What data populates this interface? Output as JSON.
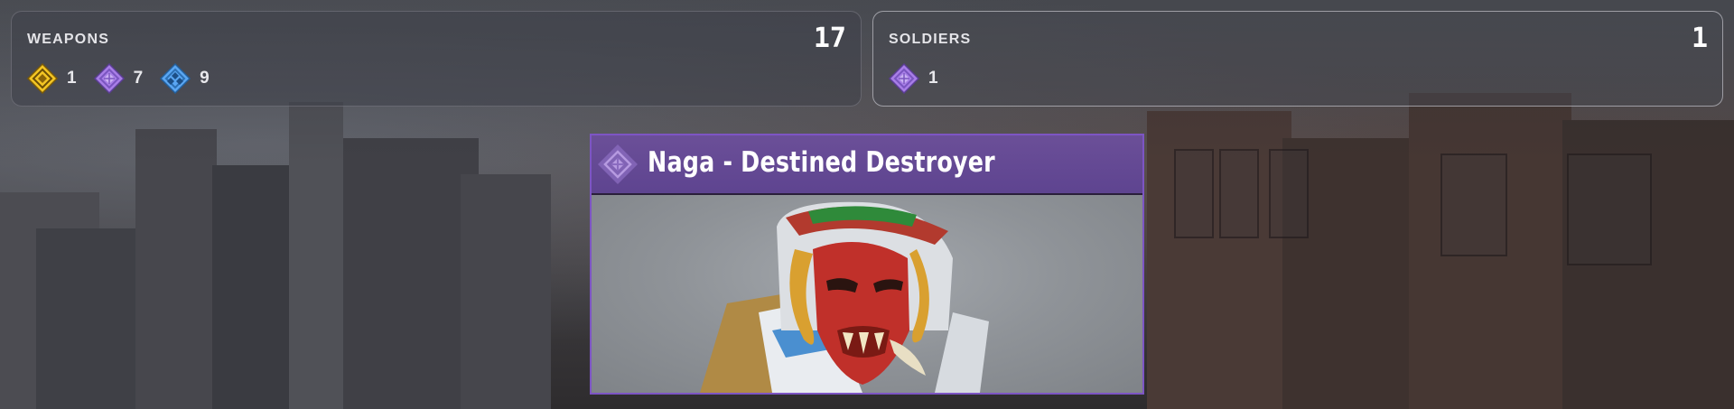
{
  "weapons": {
    "label": "WEAPONS",
    "total": "17",
    "rarities": [
      {
        "icon": "rare-diamond-icon",
        "color": "#f3c524",
        "count": "1"
      },
      {
        "icon": "epic-diamond-icon",
        "color": "#a77de6",
        "count": "7"
      },
      {
        "icon": "blue-diamond-icon",
        "color": "#5aa6f2",
        "count": "9"
      }
    ]
  },
  "soldiers": {
    "label": "SOLDIERS",
    "total": "1",
    "rarities": [
      {
        "icon": "epic-diamond-icon",
        "color": "#a77de6",
        "count": "1"
      }
    ]
  },
  "featured": {
    "name": "Naga - Destined Destroyer",
    "rarity_color": "#7d55c4",
    "header_icon": "epic-rarity-icon"
  }
}
